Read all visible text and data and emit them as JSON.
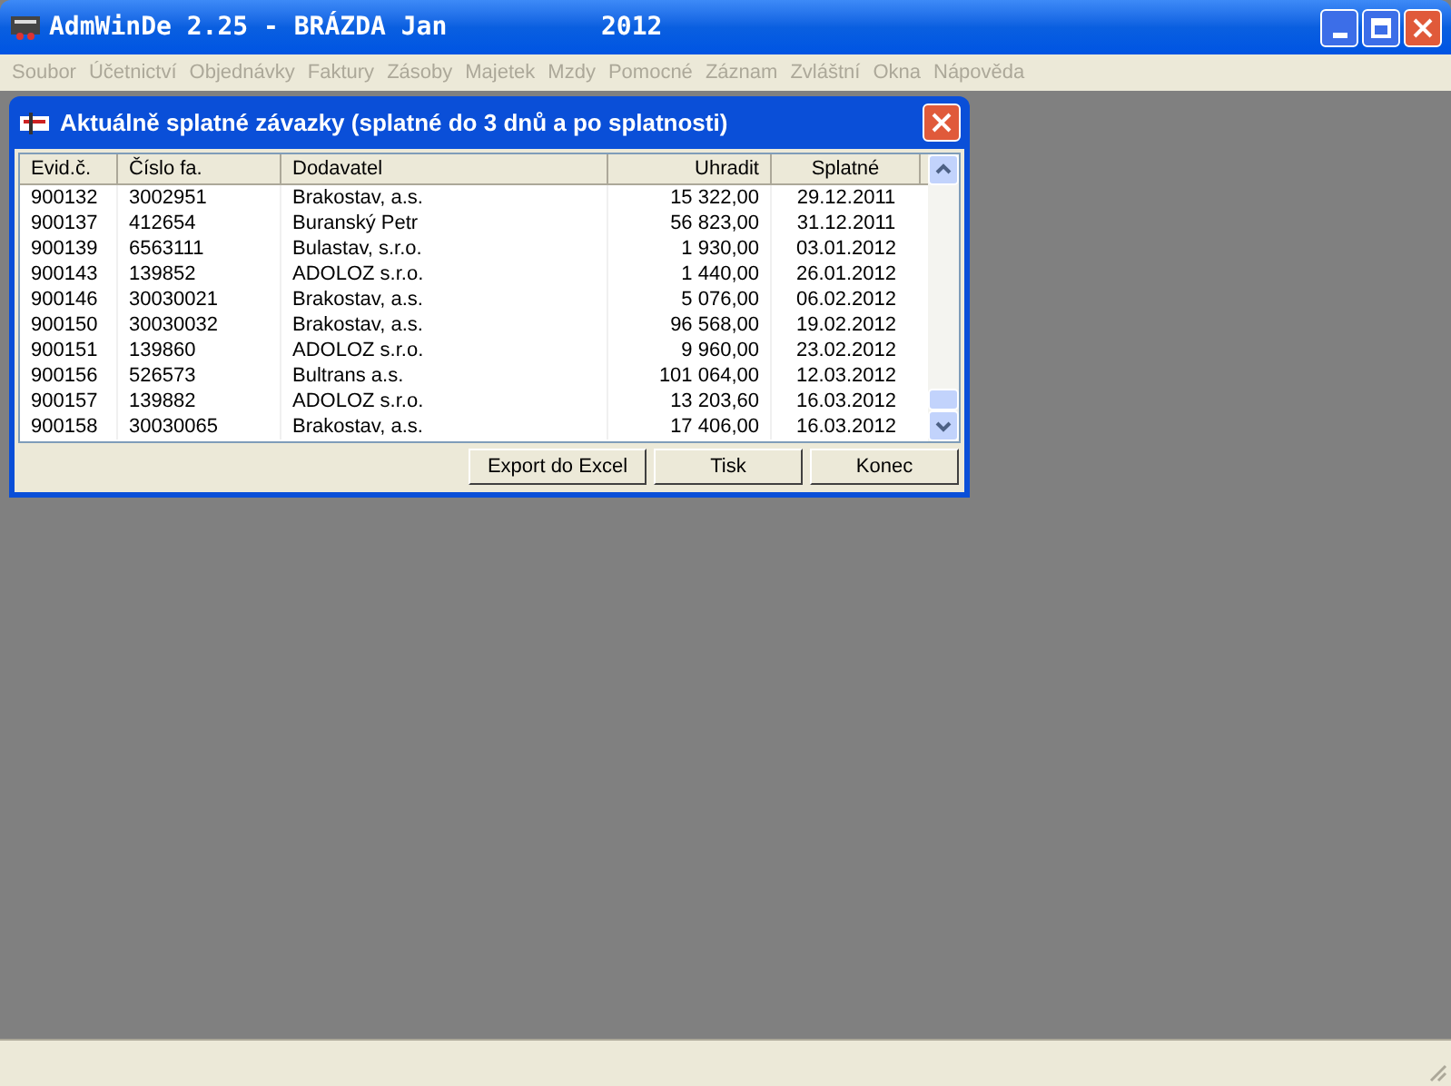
{
  "window": {
    "title": "AdmWinDe 2.25 - BRÁZDA Jan",
    "year": "2012"
  },
  "menu": [
    {
      "label": "Soubor",
      "disabled": true
    },
    {
      "label": "Účetnictví",
      "disabled": true
    },
    {
      "label": "Objednávky",
      "disabled": true
    },
    {
      "label": "Faktury",
      "disabled": true
    },
    {
      "label": "Zásoby",
      "disabled": true
    },
    {
      "label": "Majetek",
      "disabled": true
    },
    {
      "label": "Mzdy",
      "disabled": true
    },
    {
      "label": "Pomocné",
      "disabled": true
    },
    {
      "label": "Záznam",
      "disabled": true
    },
    {
      "label": "Zvláštní",
      "disabled": true
    },
    {
      "label": "Okna",
      "disabled": true
    },
    {
      "label": "Nápověda",
      "disabled": true
    }
  ],
  "dialog": {
    "title": "Aktuálně splatné závazky (splatné do 3 dnů a po splatnosti)",
    "table": {
      "columns": [
        "Evid.č.",
        "Číslo fa.",
        "Dodavatel",
        "Uhradit",
        "Splatné"
      ],
      "rows": [
        [
          "900132",
          "3002951",
          "Brakostav, a.s.",
          "15 322,00",
          "29.12.2011"
        ],
        [
          "900137",
          "412654",
          "Buranský Petr",
          "56 823,00",
          "31.12.2011"
        ],
        [
          "900139",
          "6563111",
          "Bulastav, s.r.o.",
          "1 930,00",
          "03.01.2012"
        ],
        [
          "900143",
          "139852",
          "ADOLOZ s.r.o.",
          "1 440,00",
          "26.01.2012"
        ],
        [
          "900146",
          "30030021",
          "Brakostav, a.s.",
          "5 076,00",
          "06.02.2012"
        ],
        [
          "900150",
          "30030032",
          "Brakostav, a.s.",
          "96 568,00",
          "19.02.2012"
        ],
        [
          "900151",
          "139860",
          "ADOLOZ s.r.o.",
          "9 960,00",
          "23.02.2012"
        ],
        [
          "900156",
          "526573",
          "Bultrans a.s.",
          "101 064,00",
          "12.03.2012"
        ],
        [
          "900157",
          "139882",
          "ADOLOZ s.r.o.",
          "13 203,60",
          "16.03.2012"
        ],
        [
          "900158",
          "30030065",
          "Brakostav, a.s.",
          "17 406,00",
          "16.03.2012"
        ]
      ]
    },
    "buttons": [
      "Export do Excel",
      "Tisk",
      "Konec"
    ]
  }
}
